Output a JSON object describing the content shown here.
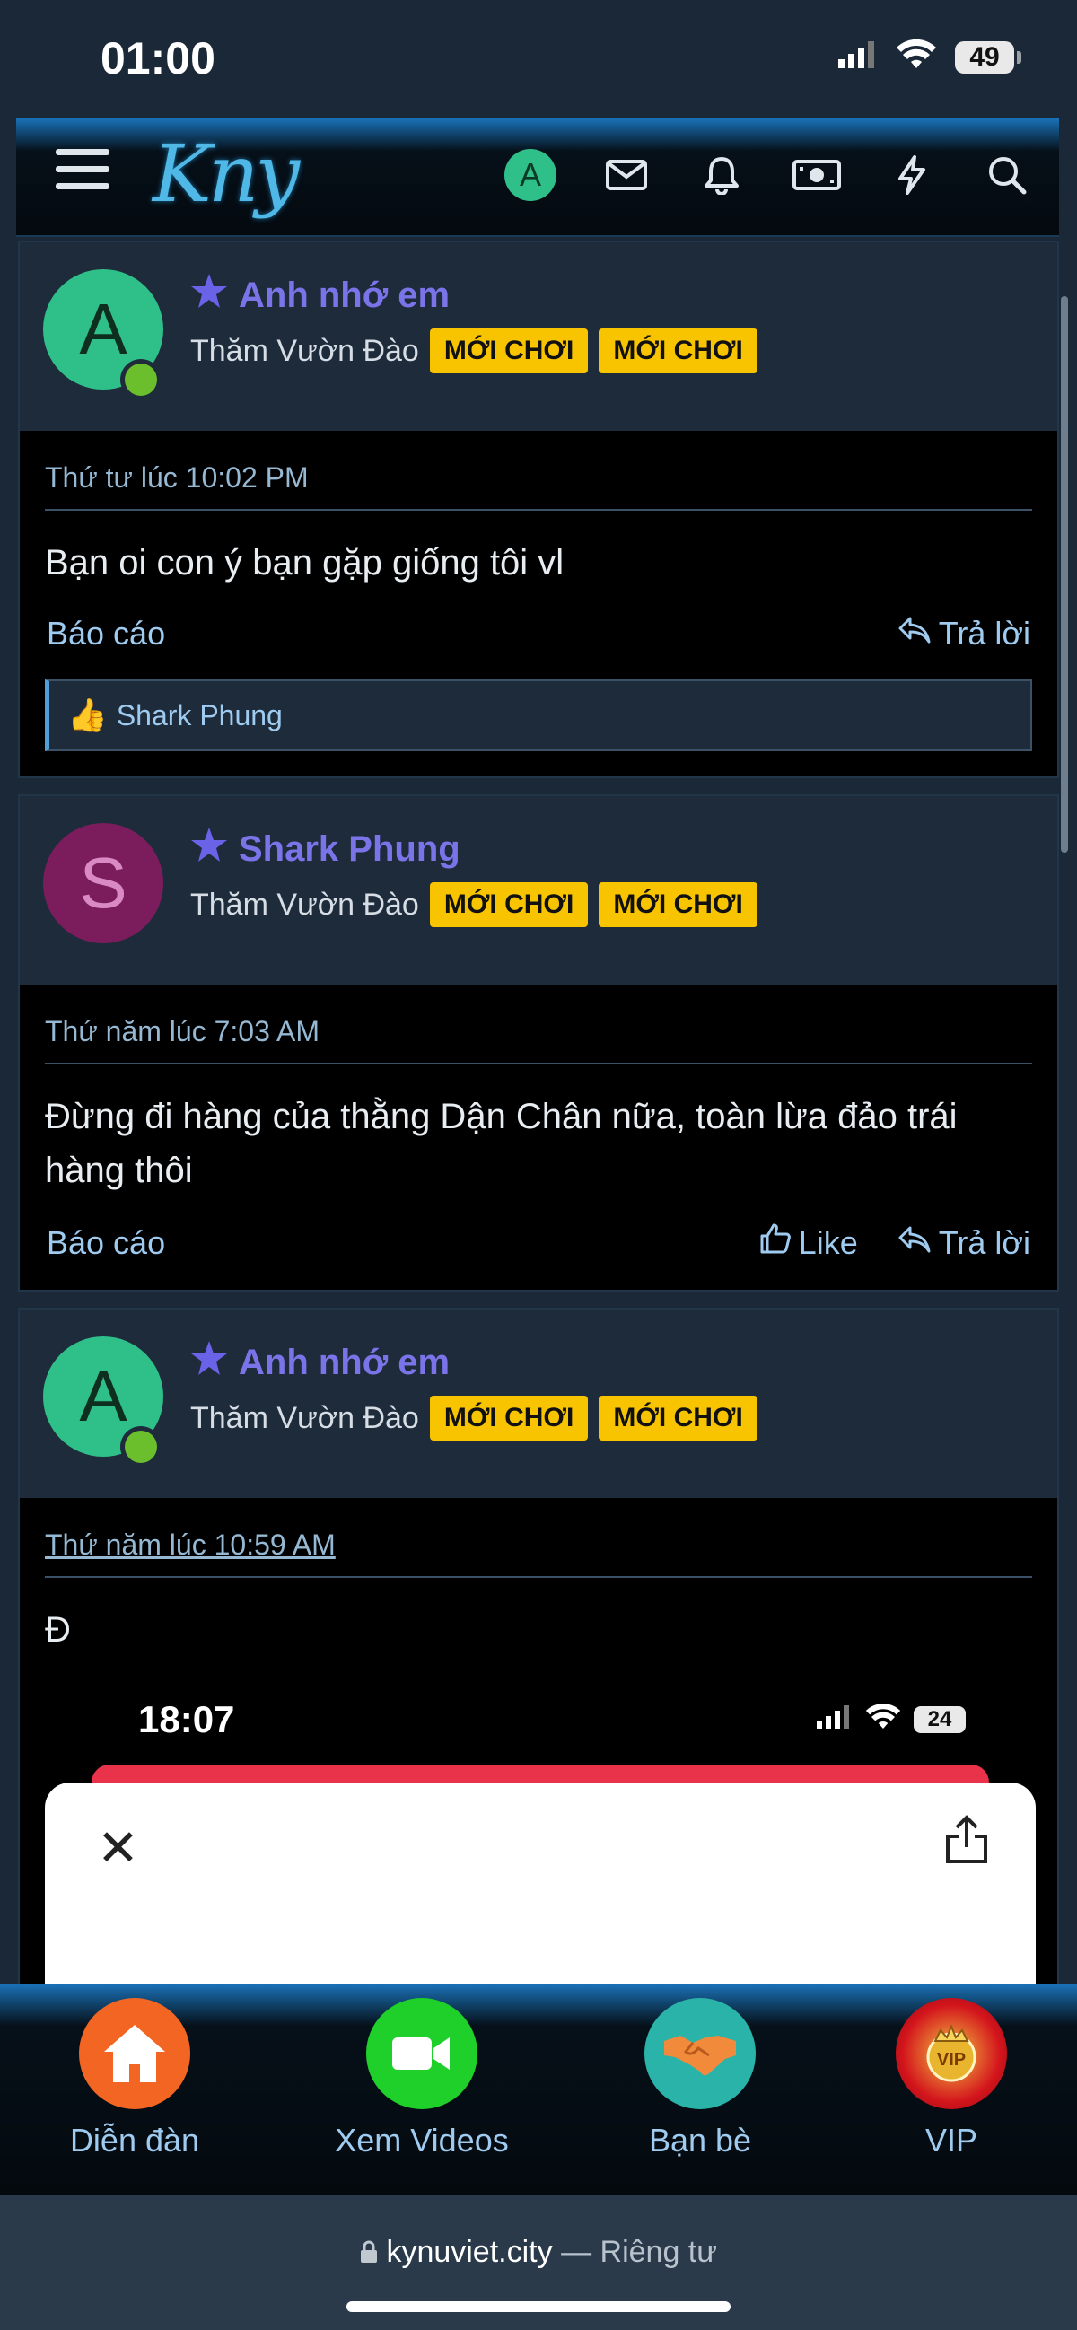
{
  "status": {
    "time": "01:00",
    "battery": "49"
  },
  "header": {
    "logo": "Kny",
    "avatar_letter": "A"
  },
  "posts": [
    {
      "avatar_letter": "A",
      "username": "Anh nhớ em",
      "role": "Thăm Vườn Đào",
      "badges": [
        "MỚI CHƠI",
        "MỚI CHƠI"
      ],
      "date": "Thứ tư lúc 10:02 PM",
      "text": "Bạn oi con ý bạn gặp giống tôi vl",
      "report": "Báo cáo",
      "reply": "Trả lời",
      "liked_by": "Shark Phung"
    },
    {
      "avatar_letter": "S",
      "username": "Shark Phung",
      "role": "Thăm Vườn Đào",
      "badges": [
        "MỚI CHƠI",
        "MỚI CHƠI"
      ],
      "date": "Thứ năm lúc 7:03 AM",
      "text": "Đừng đi hàng của thằng Dận Chân nữa, toàn lừa đảo trái hàng thôi",
      "report": "Báo cáo",
      "like": "Like",
      "reply": "Trả lời"
    },
    {
      "avatar_letter": "A",
      "username": "Anh nhớ em",
      "role": "Thăm Vườn Đào",
      "badges": [
        "MỚI CHƠI",
        "MỚI CHƠI"
      ],
      "date": "Thứ năm lúc 10:59 AM",
      "text": "Đ",
      "embed": {
        "time": "18:07",
        "battery": "24"
      }
    }
  ],
  "bottom_nav": [
    {
      "label": "Diễn đàn",
      "color": "#f26522"
    },
    {
      "label": "Xem Videos",
      "color": "#1fcf2a"
    },
    {
      "label": "Bạn bè",
      "color": "#2ab3a8"
    },
    {
      "label": "VIP",
      "color": "#c8141a"
    }
  ],
  "url_bar": {
    "domain": "kynuviet.city",
    "suffix": "— Riêng tư"
  }
}
